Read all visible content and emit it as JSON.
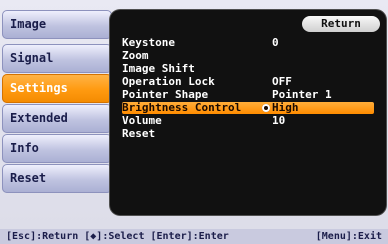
{
  "menu": {
    "items": [
      {
        "label": "Image"
      },
      {
        "label": "Signal"
      },
      {
        "label": "Settings"
      },
      {
        "label": "Extended"
      },
      {
        "label": "Info"
      },
      {
        "label": "Reset"
      }
    ],
    "selected": "Settings"
  },
  "panel": {
    "return_label": "Return",
    "rows": [
      {
        "label": "Keystone",
        "value": "0"
      },
      {
        "label": "Zoom",
        "value": ""
      },
      {
        "label": "Image Shift",
        "value": ""
      },
      {
        "label": "Operation Lock",
        "value": "OFF"
      },
      {
        "label": "Pointer Shape",
        "value": "Pointer 1"
      },
      {
        "label": "Brightness Control",
        "value": "High"
      },
      {
        "label": "Volume",
        "value": "10"
      },
      {
        "label": "Reset",
        "value": ""
      }
    ],
    "highlighted_row": "Brightness Control"
  },
  "footer": {
    "hint": "[Esc]:Return [◆]:Select [Enter]:Enter",
    "exit": "[Menu]:Exit"
  },
  "colors": {
    "accent": "#ff9a10",
    "panel_bg": "#111111",
    "tab_bg": "#bfc3e0"
  }
}
